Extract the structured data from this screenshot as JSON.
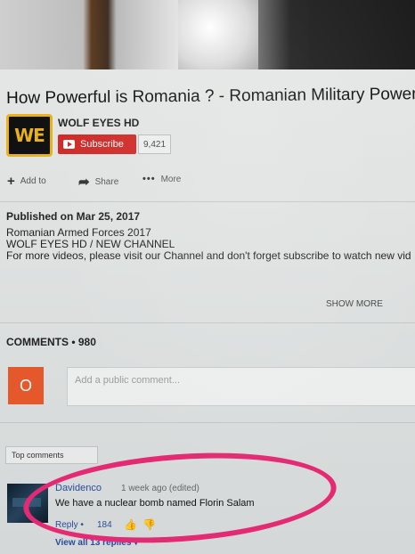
{
  "video": {
    "title": "How Powerful is Romania ? - Romanian Military Power"
  },
  "channel": {
    "logo_text": "WE",
    "name": "WOLF EYES HD",
    "subscribe_label": "Subscribe",
    "subscriber_count": "9,421"
  },
  "actions": {
    "add_to": "Add to",
    "share": "Share",
    "more": "More"
  },
  "description": {
    "published": "Published on Mar 25, 2017",
    "lines": [
      "Romanian Armed Forces 2017",
      "WOLF EYES HD / NEW CHANNEL",
      "For more videos, please visit our Channel and don't forget subscribe to watch new vid"
    ],
    "show_more": "SHOW MORE"
  },
  "comments": {
    "header": "COMMENTS • 980",
    "avatar_letter": "O",
    "input_placeholder": "Add a public comment...",
    "sort_label": "Top comments",
    "items": [
      {
        "author": "Davidenco",
        "time": "1 week ago (edited)",
        "text": "We have a nuclear bomb named Florin Salam",
        "reply": "Reply •",
        "likes": "184",
        "view_replies": "View all 13 replies"
      }
    ]
  },
  "colors": {
    "subscribe_red": "#cf2a27",
    "avatar_orange": "#e4582b",
    "highlight_pink": "#e32a73",
    "link_blue": "#2b4b9b",
    "logo_gold": "#e7b21b"
  },
  "icons": {
    "add": "plus-icon",
    "share": "share-arrow-icon",
    "more": "dots-icon",
    "like": "thumbs-up-icon",
    "dislike": "thumbs-down-icon"
  }
}
